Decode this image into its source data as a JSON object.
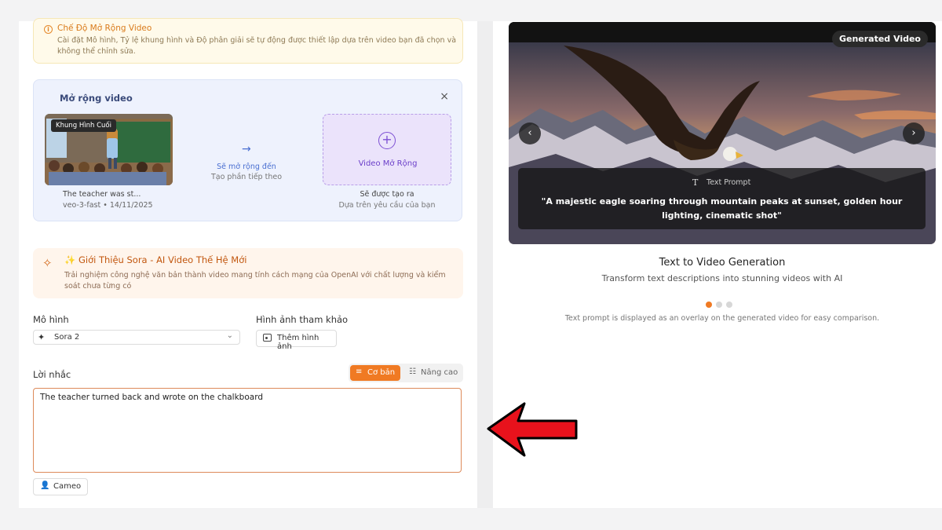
{
  "info_banner": {
    "title": "Chế Độ Mở Rộng Video",
    "text": "Cài đặt Mô hình, Tỷ lệ khung hình và Độ phân giải sẽ tự động được thiết lập dựa trên video bạn đã chọn và không thể chỉnh sửa."
  },
  "extend": {
    "title": "Mở rộng video",
    "close": "×",
    "source": {
      "badge": "Khung Hình Cuối",
      "caption": "The teacher was st...",
      "meta": "veo-3-fast • 14/11/2025"
    },
    "middle": {
      "label": "Sẽ mở rộng đến",
      "sub": "Tạo phần tiếp theo"
    },
    "target": {
      "label": "Video Mở Rộng",
      "caption": "Sẽ được tạo ra",
      "sub": "Dựa trên yêu cầu của bạn"
    }
  },
  "sora_banner": {
    "title": "✨ Giới Thiệu Sora - AI Video Thế Hệ Mới",
    "text": "Trải nghiệm công nghệ văn bản thành video mang tính cách mạng của OpenAI với chất lượng và kiểm soát chưa từng có"
  },
  "model": {
    "label": "Mô hình",
    "value": "Sora 2"
  },
  "reference": {
    "label": "Hình ảnh tham khảo",
    "button": "Thêm hình ảnh"
  },
  "prompt": {
    "label": "Lời nhắc",
    "mode_basic": "Cơ bản",
    "mode_advanced": "Nâng cao",
    "value": "The teacher turned back and wrote on the chalkboard"
  },
  "cameo": {
    "label": "Cameo"
  },
  "preview": {
    "badge": "Generated Video",
    "overlay_label": "Text Prompt",
    "overlay_quote": "\"A majestic eagle soaring through mountain peaks at sunset, golden hour lighting, cinematic shot\"",
    "title": "Text to Video Generation",
    "subtitle": "Transform text descriptions into stunning videos with AI",
    "note": "Text prompt is displayed as an overlay on the generated video for easy comparison.",
    "carousel": {
      "count": 3,
      "active": 1
    }
  },
  "colors": {
    "accent": "#f07a23",
    "extend_purple": "#7d4fd3",
    "link_blue": "#4a6fd1",
    "arrow_red": "#e8121c"
  }
}
